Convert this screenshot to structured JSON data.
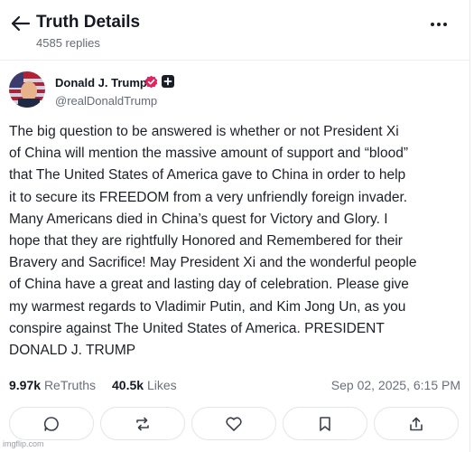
{
  "header": {
    "title": "Truth Details",
    "replies": "4585 replies",
    "back_icon": "arrow-left-icon",
    "more_icon": "more-horizontal-icon"
  },
  "author": {
    "name": "Donald J. Trump",
    "handle": "@realDonaldTrump",
    "verified_color": "#e0245e"
  },
  "post": {
    "text": "The big question to be  answered is whether or not President Xi\nof China will mention the massive amount of  support and “blood”\nthat The United States of America gave to China in order to help\nit to secure its FREEDOM from a very unfriendly foreign invader.\nMany Americans died in China’s quest for Victory and Glory. I\nhope that they are rightfully Honored and Remembered for their\nBravery and Sacrifice! May President Xi and the wonderful people\nof China have a great and lasting day of celebration. Please give\nmy warmest regards to Vladimir Putin, and Kim Jong Un, as you\nconspire against The United States of America. PRESIDENT\nDONALD J. TRUMP"
  },
  "stats": {
    "retruths_count": "9.97k",
    "retruths_label": "ReTruths",
    "likes_count": "40.5k",
    "likes_label": "Likes",
    "timestamp": "Sep 02, 2025, 6:15 PM"
  },
  "actions": [
    {
      "icon": "reply-icon"
    },
    {
      "icon": "retruth-icon"
    },
    {
      "icon": "like-icon"
    },
    {
      "icon": "bookmark-icon"
    },
    {
      "icon": "share-icon"
    }
  ],
  "watermark": "imgflip.com"
}
